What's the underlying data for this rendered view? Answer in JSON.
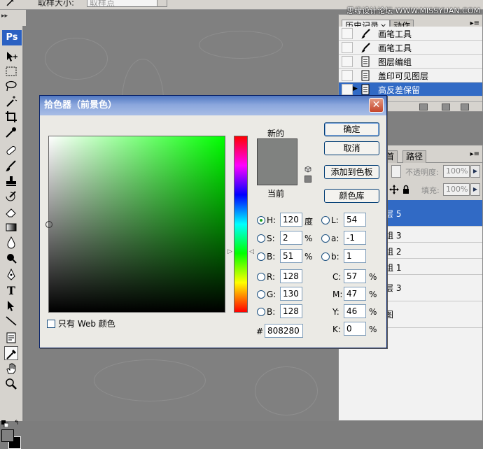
{
  "options_bar": {
    "sample_size_label": "取样大小:",
    "sample_size_value": "取样点"
  },
  "watermark": "思缘设计论坛 WWW.MISSYUAN.COM",
  "toolbox": {
    "logo": "Ps",
    "swap_glyph": "↰"
  },
  "history_panel": {
    "tab_history": "历史记录",
    "tab_actions": "动作",
    "close_glyph": "×",
    "menu_glyph": "▸≡",
    "items": [
      {
        "label": "画笔工具",
        "icon": "brush-icon"
      },
      {
        "label": "画笔工具",
        "icon": "brush-icon"
      },
      {
        "label": "图层编组",
        "icon": "document-icon"
      },
      {
        "label": "盖印可见图层",
        "icon": "document-icon"
      },
      {
        "label": "高反差保留",
        "icon": "document-icon",
        "selected": true
      }
    ]
  },
  "layers_panel": {
    "tab_channels": "首",
    "tab_paths": "路径",
    "menu_glyph": "▸≡",
    "opacity_label": "不透明度:",
    "opacity_value": "100%",
    "fill_label": "填充:",
    "fill_value": "100%",
    "arrow": "▶",
    "layers": [
      {
        "label": "层 5",
        "selected": true
      },
      {
        "label": "组 3"
      },
      {
        "label": "组 2"
      },
      {
        "label": "组 1"
      },
      {
        "label": "层 3"
      },
      {
        "label": "图"
      }
    ]
  },
  "color_picker": {
    "title": "拾色器（前景色）",
    "close_glyph": "✕",
    "new_label": "新的",
    "current_label": "当前",
    "new_color": "#808280",
    "current_color": "#808280",
    "buttons": {
      "ok": "确定",
      "cancel": "取消",
      "add_to_swatches": "添加到色板",
      "color_libraries": "颜色库"
    },
    "hsb": {
      "h_label": "H:",
      "h_value": "120",
      "h_unit": "度",
      "s_label": "S:",
      "s_value": "2",
      "s_unit": "%",
      "b_label": "B:",
      "b_value": "51",
      "b_unit": "%"
    },
    "rgb": {
      "r_label": "R:",
      "r_value": "128",
      "g_label": "G:",
      "g_value": "130",
      "b_label": "B:",
      "b_value": "128"
    },
    "lab": {
      "l_label": "L:",
      "l_value": "54",
      "a_label": "a:",
      "a_value": "-1",
      "b_label": "b:",
      "b_value": "1"
    },
    "cmyk": {
      "c_label": "C:",
      "c_value": "57",
      "c_unit": "%",
      "m_label": "M:",
      "m_value": "47",
      "m_unit": "%",
      "y_label": "Y:",
      "y_value": "46",
      "y_unit": "%",
      "k_label": "K:",
      "k_value": "0",
      "k_unit": "%"
    },
    "hex_label": "#",
    "hex_value": "808280",
    "web_only_label": "只有 Web 颜色",
    "selected_mode": "H",
    "hue_color": "#00ff00"
  }
}
